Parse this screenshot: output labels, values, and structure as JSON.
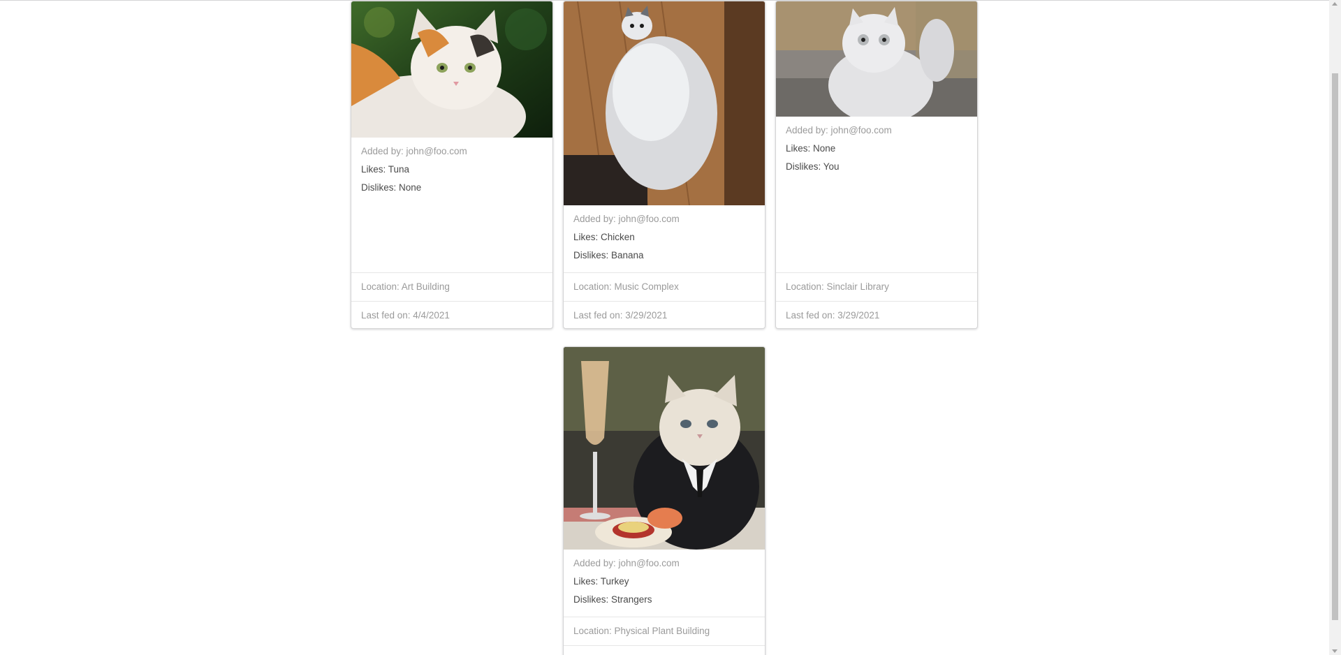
{
  "cards": [
    {
      "image_label": "calico-cat-photo",
      "added_by": "Added by: john@foo.com",
      "likes": "Likes: Tuna",
      "dislikes": "Dislikes: None",
      "location": "Location: Art Building",
      "last_fed": "Last fed on: 4/4/2021"
    },
    {
      "image_label": "fluffy-gray-cat-photo",
      "added_by": "Added by: john@foo.com",
      "likes": "Likes: Chicken",
      "dislikes": "Dislikes: Banana",
      "location": "Location: Music Complex",
      "last_fed": "Last fed on: 3/29/2021"
    },
    {
      "image_label": "white-persian-cat-photo",
      "added_by": "Added by: john@foo.com",
      "likes": "Likes: None",
      "dislikes": "Dislikes: You",
      "location": "Location: Sinclair Library",
      "last_fed": "Last fed on: 3/29/2021"
    },
    {
      "image_label": "tuxedo-cat-dinner-photo",
      "added_by": "Added by: john@foo.com",
      "likes": "Likes: Turkey",
      "dislikes": "Dislikes: Strangers",
      "location": "Location: Physical Plant Building",
      "last_fed": ""
    }
  ]
}
